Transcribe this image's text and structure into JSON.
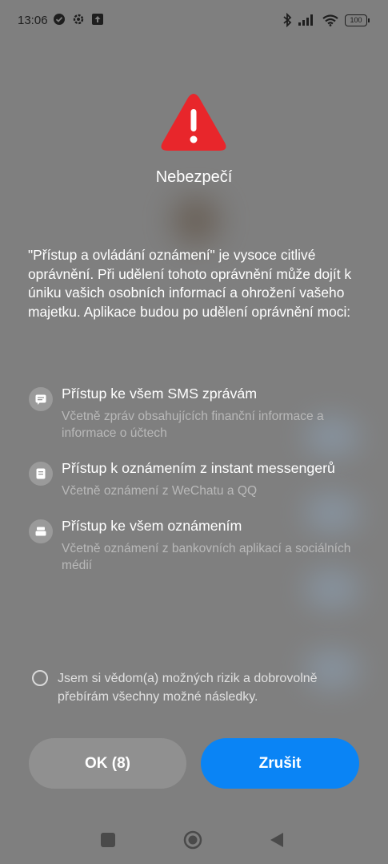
{
  "status_bar": {
    "time": "13:06",
    "battery": "100",
    "left_icons": [
      "check-circle-icon",
      "settings-gear-icon",
      "upload-icon"
    ],
    "right_icons": [
      "bluetooth-icon",
      "cellular-signal-icon",
      "wifi-icon",
      "battery-icon"
    ]
  },
  "dialog": {
    "title": "Nebezpečí",
    "intro": "\"Přístup a ovládání oznámení\" je vysoce citlivé oprávnění. Při udělení tohoto oprávnění může dojít k úniku vašich osobních informací a ohrožení vašeho majetku. Aplikace budou po udělení oprávnění moci:",
    "permissions": [
      {
        "icon": "message-icon",
        "title": "Přístup ke všem SMS zprávám",
        "description": "Včetně zpráv obsahujících finanční informace a informace o účtech"
      },
      {
        "icon": "document-icon",
        "title": "Přístup k oznámením z instant messengerů",
        "description": "Včetně oznámení z WeChatu a QQ"
      },
      {
        "icon": "bank-card-icon",
        "title": "Přístup ke všem oznámením",
        "description": "Včetně oznámení z bankovních aplikací a sociálních médií"
      }
    ],
    "acknowledgement": "Jsem si vědom(a) možných rizik a dobrovolně přebírám všechny možné následky.",
    "ok_label": "OK (8)",
    "cancel_label": "Zrušit"
  },
  "colors": {
    "danger": "#e8262b",
    "primary": "#0a84f5",
    "overlay": "#7f7f7f"
  }
}
